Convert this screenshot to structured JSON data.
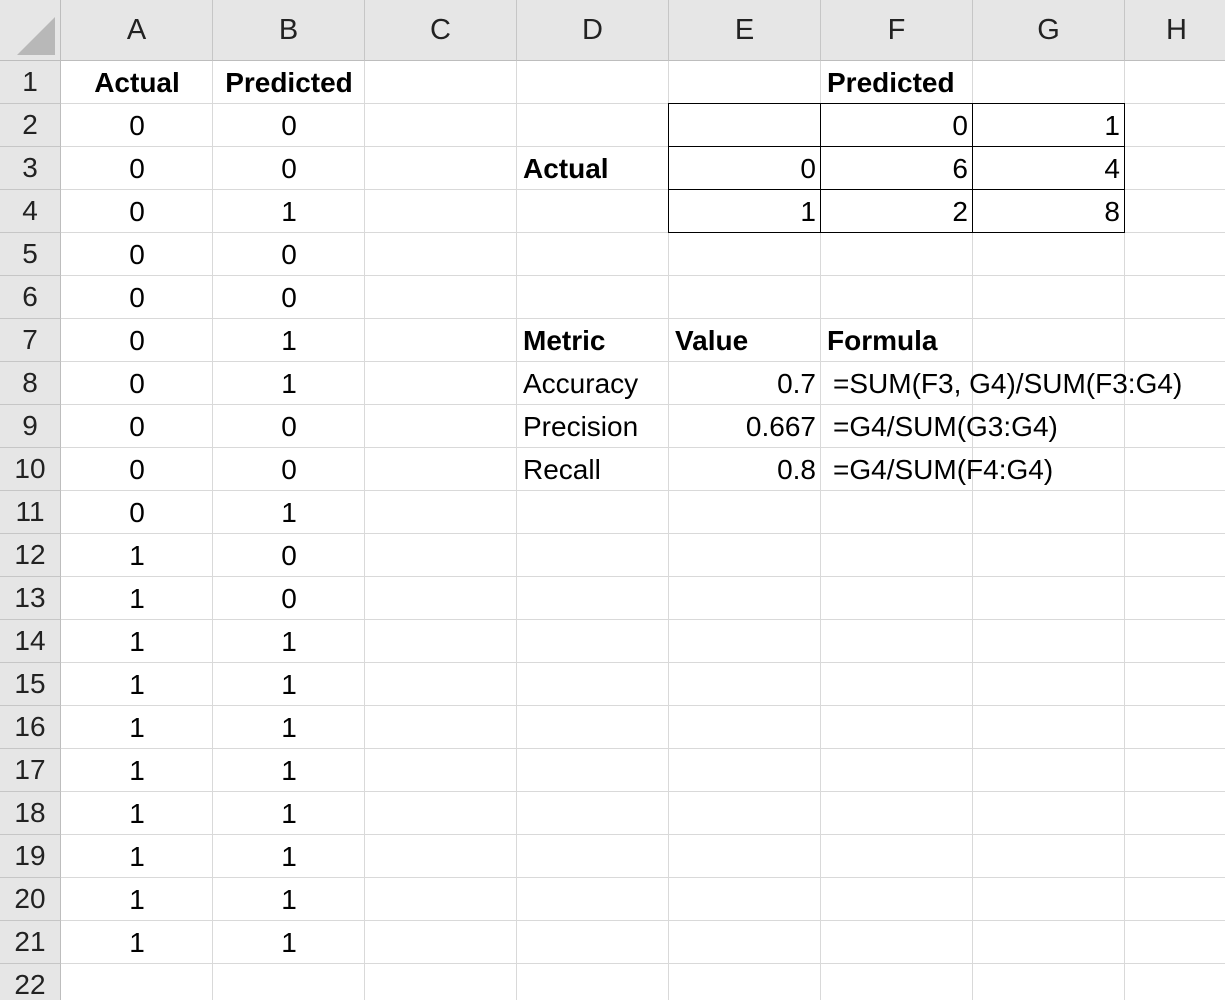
{
  "columns": [
    "A",
    "B",
    "C",
    "D",
    "E",
    "F",
    "G",
    "H"
  ],
  "rows": [
    "1",
    "2",
    "3",
    "4",
    "5",
    "6",
    "7",
    "8",
    "9",
    "10",
    "11",
    "12",
    "13",
    "14",
    "15",
    "16",
    "17",
    "18",
    "19",
    "20",
    "21",
    "22"
  ],
  "data_headers": {
    "actual": "Actual",
    "predicted": "Predicted"
  },
  "actual_values": [
    "0",
    "0",
    "0",
    "0",
    "0",
    "0",
    "0",
    "0",
    "0",
    "0",
    "1",
    "1",
    "1",
    "1",
    "1",
    "1",
    "1",
    "1",
    "1",
    "1"
  ],
  "predicted_values": [
    "0",
    "0",
    "1",
    "0",
    "0",
    "1",
    "1",
    "0",
    "0",
    "1",
    "0",
    "0",
    "1",
    "1",
    "1",
    "1",
    "1",
    "1",
    "1",
    "1"
  ],
  "confusion_matrix": {
    "predicted_label": "Predicted",
    "actual_label": "Actual",
    "col_labels": [
      "0",
      "1"
    ],
    "row_labels": [
      "0",
      "1"
    ],
    "cells": [
      [
        "6",
        "4"
      ],
      [
        "2",
        "8"
      ]
    ]
  },
  "metrics": {
    "headers": [
      "Metric",
      "Value",
      "Formula"
    ],
    "rows": [
      {
        "metric": "Accuracy",
        "value": "0.7",
        "formula": "=SUM(F3, G4)/SUM(F3:G4)"
      },
      {
        "metric": "Precision",
        "value": "0.667",
        "formula": "=G4/SUM(G3:G4)"
      },
      {
        "metric": "Recall",
        "value": "0.8",
        "formula": "=G4/SUM(F4:G4)"
      }
    ]
  }
}
